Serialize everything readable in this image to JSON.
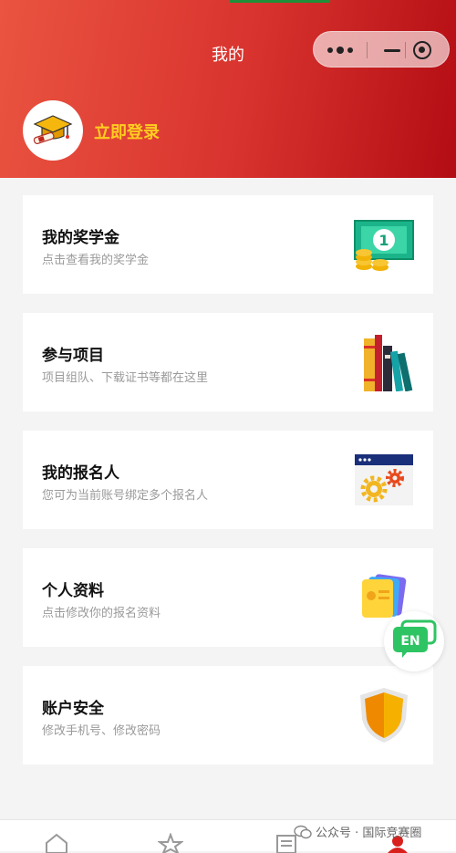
{
  "header": {
    "title": "我的",
    "login_label": "立即登录",
    "brand_start": "#ea5440",
    "brand_end": "#b30d14",
    "login_color": "#ffcd1f"
  },
  "capsule": {
    "more_icon": "more-dots-icon",
    "minimize_icon": "minimize-icon",
    "close_icon": "target-close-icon"
  },
  "menu": [
    {
      "title": "我的奖学金",
      "subtitle": "点击查看我的奖学金",
      "icon": "money-coins-icon"
    },
    {
      "title": "参与项目",
      "subtitle": "项目组队、下载证书等都在这里",
      "icon": "books-icon"
    },
    {
      "title": "我的报名人",
      "subtitle": "您可为当前账号绑定多个报名人",
      "icon": "settings-window-icon"
    },
    {
      "title": "个人资料",
      "subtitle": "点击修改你的报名资料",
      "icon": "profile-card-icon"
    },
    {
      "title": "账户安全",
      "subtitle": "修改手机号、修改密码",
      "icon": "shield-icon"
    }
  ],
  "language_button": {
    "label": "EN",
    "color": "#2ec463"
  },
  "tabbar": {
    "tabs": [
      "home-icon",
      "star-icon",
      "list-icon",
      "user-icon"
    ],
    "active_color": "#d8201c"
  },
  "watermark": {
    "text": "公众号 · 国际竞赛圈"
  }
}
